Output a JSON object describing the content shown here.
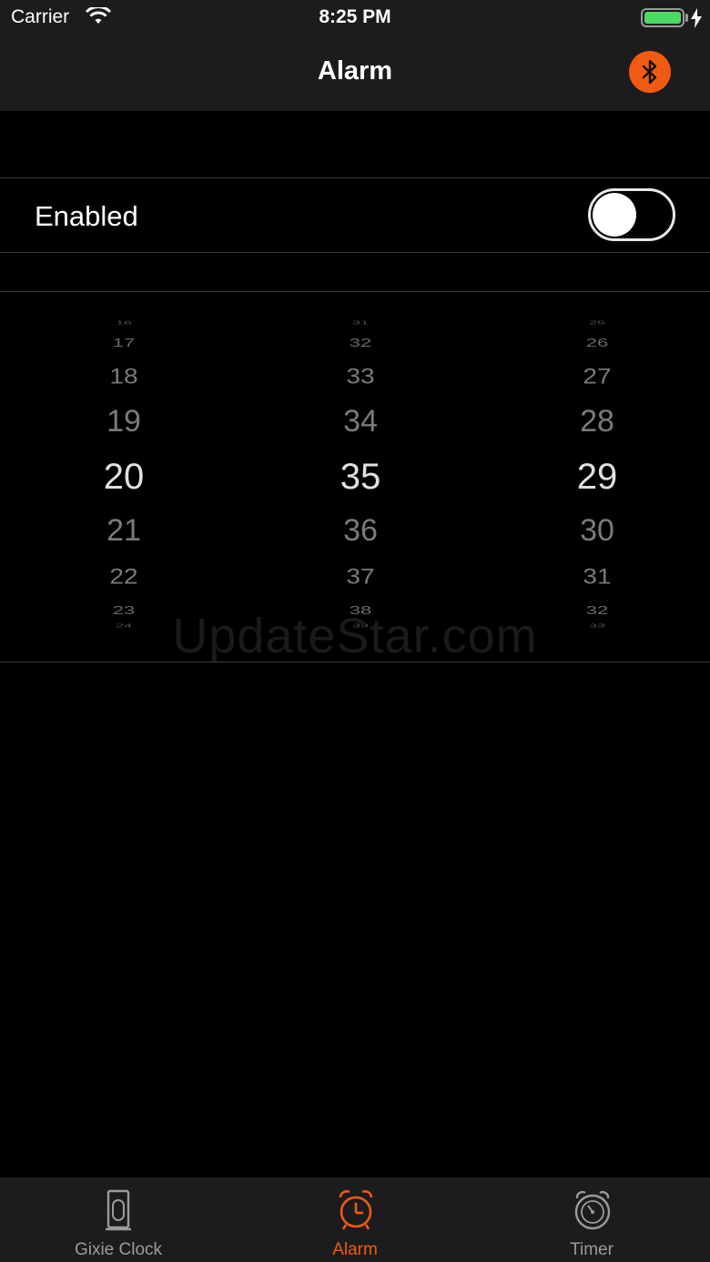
{
  "status_bar": {
    "carrier": "Carrier",
    "time": "8:25 PM",
    "battery_level": 1.0,
    "battery_color": "#4cd964"
  },
  "nav": {
    "title": "Alarm",
    "bluetooth_icon": "bluetooth-icon",
    "accent": "#f25a11"
  },
  "settings": {
    "enabled_label": "Enabled",
    "enabled": false
  },
  "picker": {
    "columns": [
      {
        "before": [
          "16",
          "17",
          "18",
          "19"
        ],
        "selected": "20",
        "after": [
          "21",
          "22",
          "23",
          "24"
        ]
      },
      {
        "before": [
          "31",
          "32",
          "33",
          "34"
        ],
        "selected": "35",
        "after": [
          "36",
          "37",
          "38",
          "39"
        ]
      },
      {
        "before": [
          "25",
          "26",
          "27",
          "28"
        ],
        "selected": "29",
        "after": [
          "30",
          "31",
          "32",
          "33"
        ]
      }
    ]
  },
  "watermark": "UpdateStar.com",
  "tabs": [
    {
      "label": "Gixie Clock",
      "icon": "gixie-clock-icon",
      "active": false
    },
    {
      "label": "Alarm",
      "icon": "alarm-clock-icon",
      "active": true
    },
    {
      "label": "Timer",
      "icon": "timer-icon",
      "active": false
    }
  ]
}
